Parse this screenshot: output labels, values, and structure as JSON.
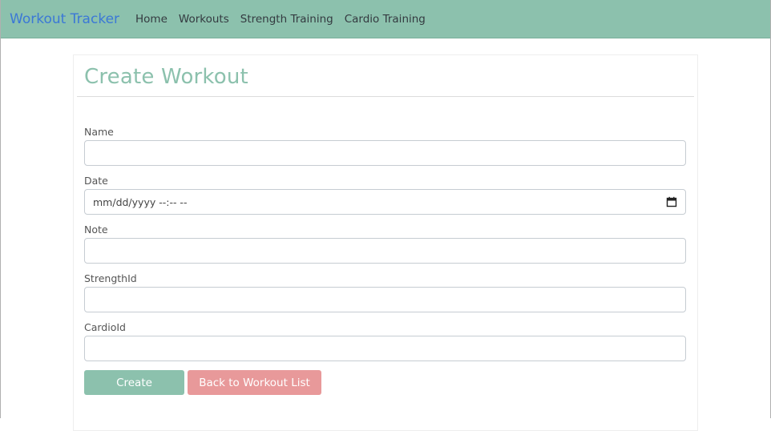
{
  "navbar": {
    "brand": "Workout Tracker",
    "links": [
      "Home",
      "Workouts",
      "Strength Training",
      "Cardio Training"
    ]
  },
  "page": {
    "title": "Create Workout"
  },
  "form": {
    "fields": [
      {
        "label": "Name",
        "value": ""
      },
      {
        "label": "Date",
        "placeholder": "mm/dd/yyyy --:-- --"
      },
      {
        "label": "Note",
        "value": ""
      },
      {
        "label": "StrengthId",
        "value": ""
      },
      {
        "label": "CardioId",
        "value": ""
      }
    ],
    "create_label": "Create",
    "back_label": "Back to Workout List"
  },
  "colors": {
    "accent": "#8cc1ad",
    "brand": "#3b78d6",
    "danger": "#e8999a"
  }
}
